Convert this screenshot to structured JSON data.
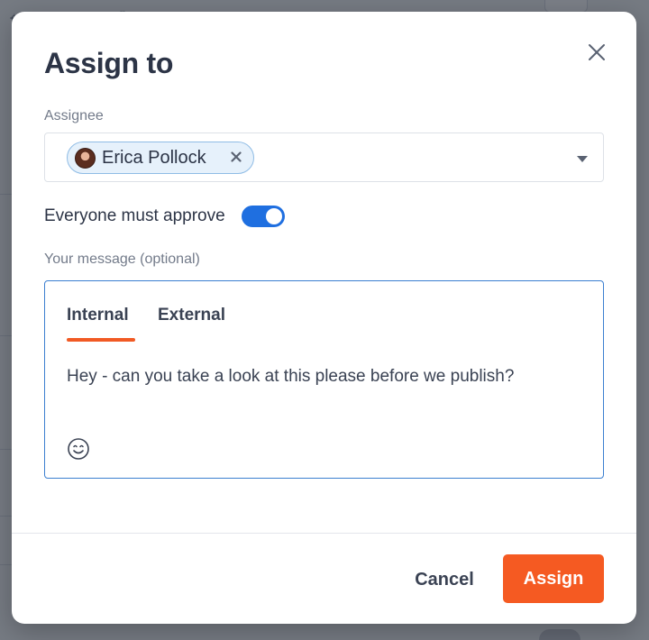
{
  "modal": {
    "title": "Assign to",
    "close_icon": "close-icon"
  },
  "assignee": {
    "label": "Assignee",
    "selected": [
      {
        "name": "Erica Pollock",
        "remove_icon": "close-icon"
      }
    ],
    "caret_icon": "chevron-down-icon"
  },
  "approval": {
    "label": "Everyone must approve",
    "enabled": true
  },
  "message": {
    "label": "Your message (optional)",
    "tabs": [
      {
        "label": "Internal",
        "active": true
      },
      {
        "label": "External",
        "active": false
      }
    ],
    "text": "Hey - can you take a look at this please before we publish?",
    "emoji_icon": "smiley-icon"
  },
  "actions": {
    "cancel_label": "Cancel",
    "assign_label": "Assign"
  },
  "colors": {
    "accent": "#f55a22",
    "toggle_on": "#1f6fe0",
    "chip_bg": "#e6f1fb",
    "chip_border": "#8fbce5",
    "focus_border": "#3b7fd0"
  }
}
